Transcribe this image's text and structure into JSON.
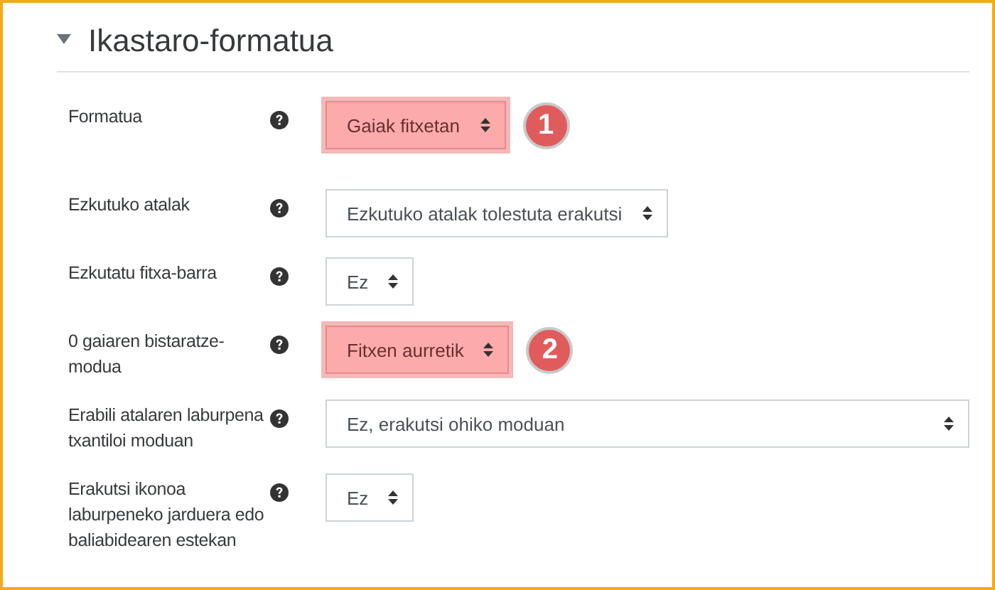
{
  "section": {
    "title": "Ikastaro-formatua",
    "expanded": true
  },
  "fields": [
    {
      "label": "Formatua",
      "value": "Gaiak fitxetan",
      "kind": "compact",
      "highlighted": true,
      "badge": "1"
    },
    {
      "label": "Ezkutuko atalak",
      "value": "Ezkutuko atalak tolestuta erakutsi",
      "kind": "compact",
      "highlighted": false
    },
    {
      "label": "Ezkutatu fitxa-barra",
      "value": "Ez",
      "kind": "compact",
      "highlighted": false
    },
    {
      "label": "0 gaiaren bistaratze-modua",
      "value": "Fitxen aurretik",
      "kind": "compact",
      "highlighted": true,
      "badge": "2"
    },
    {
      "label": "Erabili atalaren laburpena txantiloi moduan",
      "value": "Ez, erakutsi ohiko moduan",
      "kind": "wide",
      "highlighted": false
    },
    {
      "label": "Erakutsi ikonoa laburpeneko jarduera edo baliabidearen estekan",
      "value": "Ez",
      "kind": "compact",
      "highlighted": false
    }
  ]
}
